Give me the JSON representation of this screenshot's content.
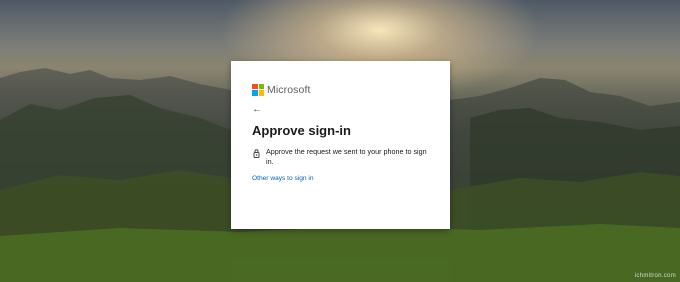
{
  "brand": {
    "name": "Microsoft",
    "logo_colors": [
      "#f25022",
      "#7fba00",
      "#00a4ef",
      "#ffb900"
    ]
  },
  "nav": {
    "back_icon": "arrow-left-icon",
    "back_glyph": "←"
  },
  "dialog": {
    "title": "Approve sign-in",
    "message": "Approve the request we sent to your phone to sign in.",
    "message_icon": "phone-lock-icon",
    "other_ways_link": "Other ways to sign in",
    "link_color": "#0067b8"
  },
  "watermark": "ichmitron.com"
}
